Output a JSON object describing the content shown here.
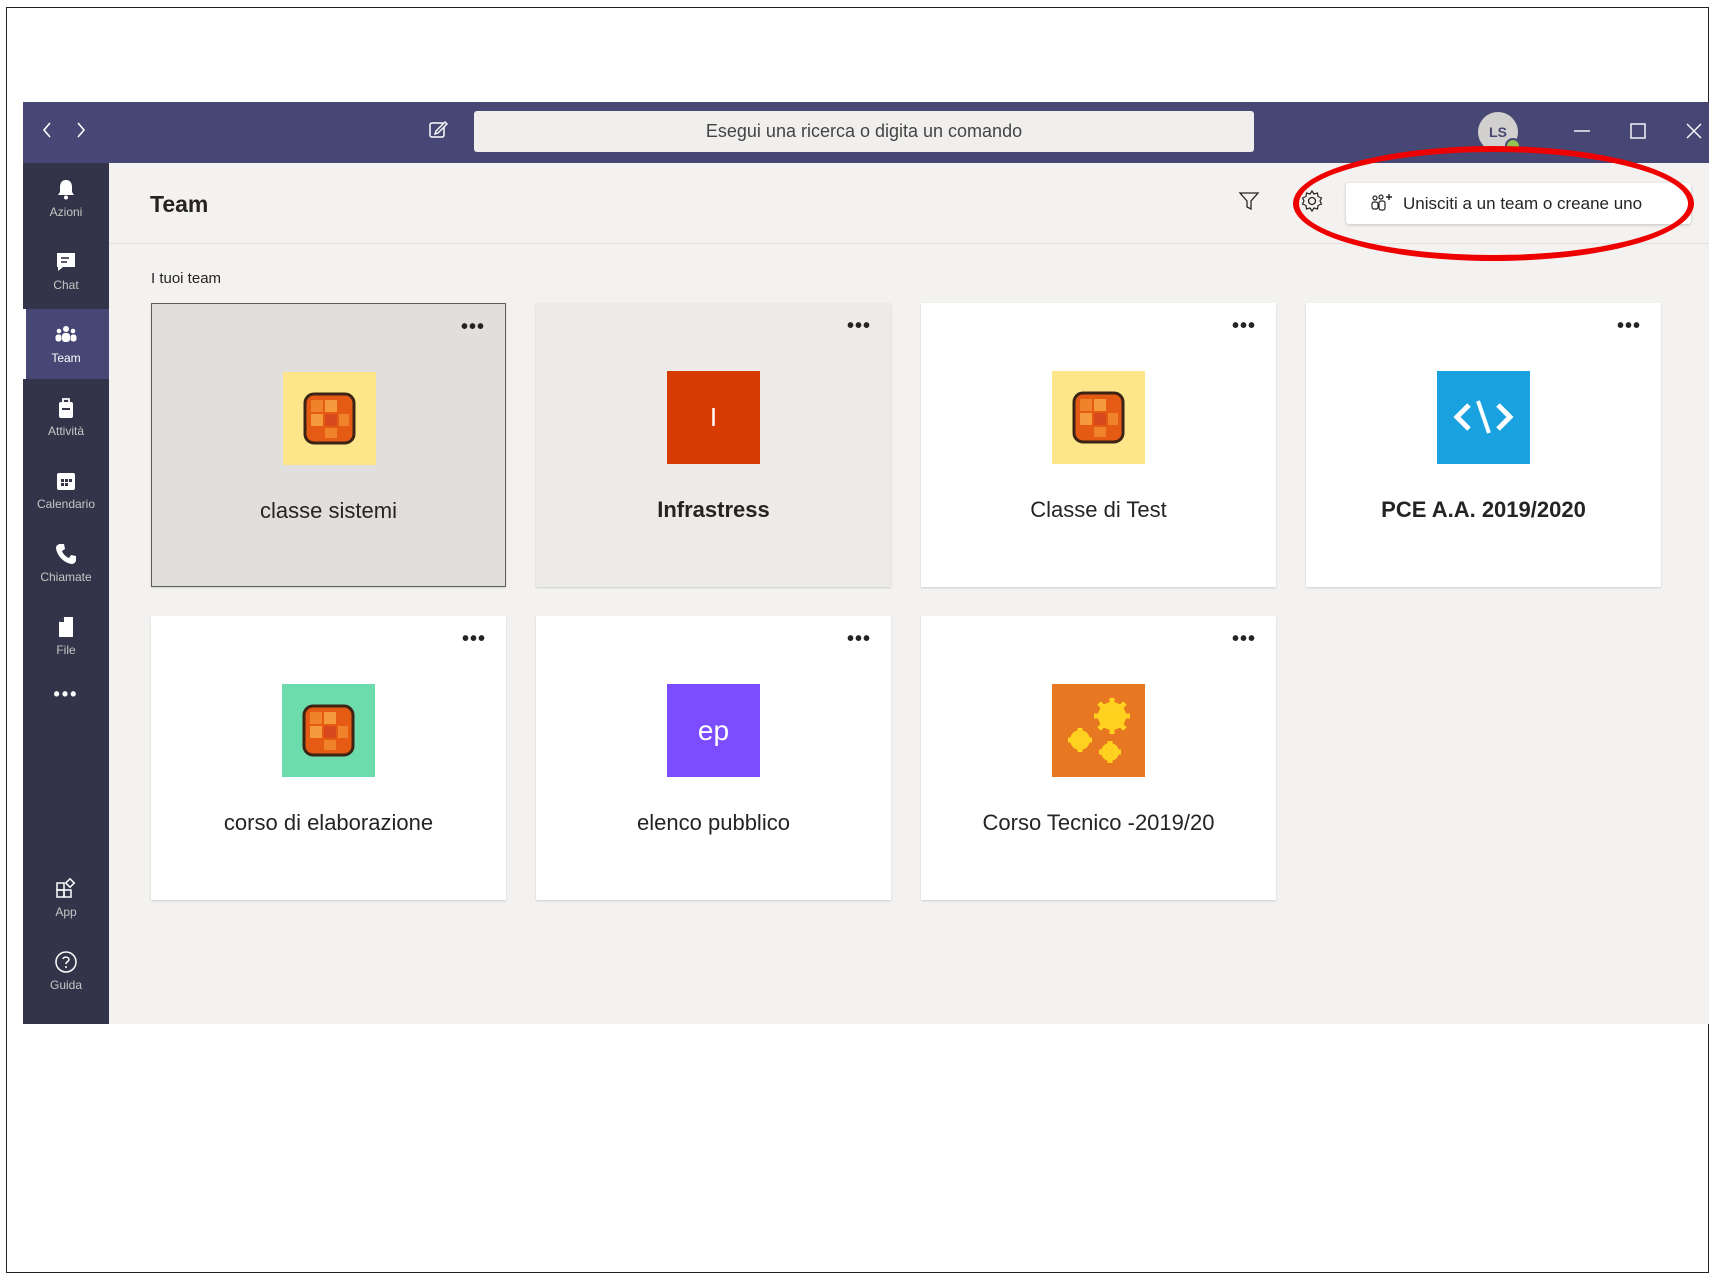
{
  "titlebar": {
    "back_icon": "chevron-left-icon",
    "forward_icon": "chevron-right-icon",
    "compose_icon": "compose-icon",
    "search_placeholder": "Esegui una ricerca o digita un comando",
    "avatar_initials": "LS",
    "minimize": "—",
    "maximize": "☐",
    "close": "✕",
    "color": "#464775"
  },
  "rail": {
    "items": [
      {
        "label": "Azioni",
        "icon": "bell-icon"
      },
      {
        "label": "Chat",
        "icon": "chat-icon"
      },
      {
        "label": "Team",
        "icon": "team-icon",
        "active": true
      },
      {
        "label": "Attività",
        "icon": "briefcase-icon"
      },
      {
        "label": "Calendario",
        "icon": "calendar-icon"
      },
      {
        "label": "Chiamate",
        "icon": "phone-icon"
      },
      {
        "label": "File",
        "icon": "file-icon"
      }
    ],
    "more": "•••",
    "bottom_items": [
      {
        "label": "App",
        "icon": "apps-icon"
      },
      {
        "label": "Guida",
        "icon": "help-icon"
      }
    ]
  },
  "header": {
    "title": "Team",
    "join_button": "Unisciti a un team o creane uno"
  },
  "section_label": "I tuoi team",
  "teams": [
    {
      "name": "classe sistemi",
      "tile": "class-icon",
      "tile_color": "#fde58a",
      "state": "selected"
    },
    {
      "name": "Infrastress",
      "tile_text": "I",
      "tile_color": "#d83b01",
      "state": "hover",
      "bold": true
    },
    {
      "name": "Classe di Test",
      "tile": "class-icon",
      "tile_color": "#fde58a"
    },
    {
      "name": "PCE A.A. 2019/2020",
      "tile": "code-icon",
      "tile_color": "#1aa1e0",
      "bold": true
    },
    {
      "name": "corso di elaborazione",
      "tile": "class-icon",
      "tile_color": "#6ddcad"
    },
    {
      "name": "elenco pubblico",
      "tile_text": "ep",
      "tile_color": "#7c4dff"
    },
    {
      "name": "Corso Tecnico -2019/20",
      "tile": "gears-icon",
      "tile_color": "#e87722"
    }
  ],
  "more_options": "•••",
  "annotation_color": "#ee0000"
}
